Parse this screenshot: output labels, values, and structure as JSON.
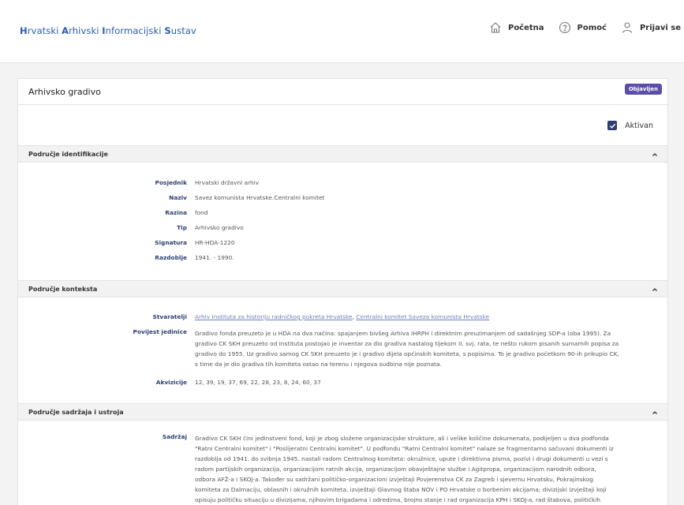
{
  "header": {
    "brand": [
      {
        "initial": "H",
        "rest": "rvatski "
      },
      {
        "initial": "A",
        "rest": "rhivski "
      },
      {
        "initial": "I",
        "rest": "nformacijski "
      },
      {
        "initial": "S",
        "rest": "ustav"
      }
    ],
    "nav": {
      "home": "Početna",
      "help": "Pomoć",
      "login": "Prijavi se"
    }
  },
  "card": {
    "title": "Arhivsko gradivo",
    "badge": "Objavljen",
    "active_label": "Aktivan"
  },
  "sections": {
    "identification": {
      "title": "Područje identifikacije",
      "fields": [
        {
          "label": "Posjednik",
          "value": "Hrvatski državni arhiv"
        },
        {
          "label": "Naziv",
          "value": "Savez komunista Hrvatske.Centralni komitet"
        },
        {
          "label": "Razina",
          "value": "fond"
        },
        {
          "label": "Tip",
          "value": "Arhivsko gradivo"
        },
        {
          "label": "Signatura",
          "value": "HR-HDA-1220"
        },
        {
          "label": "Razdoblje",
          "value": "1941. - 1990."
        }
      ]
    },
    "context": {
      "title": "Područje konteksta",
      "creators_label": "Stvaratelji",
      "creator_link_1": "Arhiv Instituta za historiju radničkog pokreta Hrvatske",
      "creator_sep": ", ",
      "creator_link_2": "Centralni komitet Saveza komunista Hrvatske",
      "history_label": "Povijest jedinice",
      "history_lines": [
        "Gradivo fonda preuzeto je u HDA na dva načina: spajanjem bivšeg Arhiva IHRPH i direktnim preuzimanjem od sadašnjeg SDP-a (oba 1995). Za",
        "gradivo CK SKH preuzeto od Instituta postojao je inventar za dio gradiva nastalog tijekom II. svj. rata, te nešto rukom pisanih sumarnih popisa za",
        "gradivo do 1955. Uz gradivo samog CK SKH preuzeto je i gradivo dijela općinskih komiteta, s popisima. To je gradivo početkom 90-ih prikupio CK,",
        "s time da je dio gradiva tih komiteta ostao na terenu i njegova sudbina nije poznata."
      ],
      "acquisitions_label": "Akvizicije",
      "acquisitions_value": "12, 39, 19, 37, 69, 22, 28, 23, 8, 24, 60, 37"
    },
    "content": {
      "title": "Područje sadržaja i ustroja",
      "content_label": "Sadržaj",
      "content_lines": [
        "Gradivo CK SKH čini jedinstveni fond, koji je zbog složene organizacijske strukture, ali i velike količine dokumenata, podijeljen u dva podfonda",
        "\"Ratni Centralni komitet\" i \"Poslijeratni Centralni komitet\". U podfondu \"Ratni Centralni komitet\" nalaze se fragmentarno sačuvani dokumenti iz",
        "razdoblja od 1941. do svibnja 1945. nastali radom Centralnog komiteta: okružnice, upute i direktivna pisma, pozivi i drugi dokumenti u vezi s",
        "radom partijskih organizacija, organizacijom ratnih akcija, organizacijom obavještajne službe i Agitpropa, organizacijom narodnih odbora,",
        "odbora AFŽ-a i SKOJ-a. Također su sadržani političko-organizacioni izvještaji Povjerenstva CK za Zagreb i sjevernu Hrvatsku, Pokrajinskog",
        "komiteta za Dalmaciju, oblasnih i okružnih komiteta, izvještaji Glavnog štaba NOV i PO Hrvatske o borbenim akcijama; divizijski izvještaji koji",
        "opisuju političku situaciju u divizijama, njihovim brigadama i odredima, brojno stanje i rad organizacija KPH i SKOJ-a, rad štabova, političkih"
      ]
    }
  }
}
